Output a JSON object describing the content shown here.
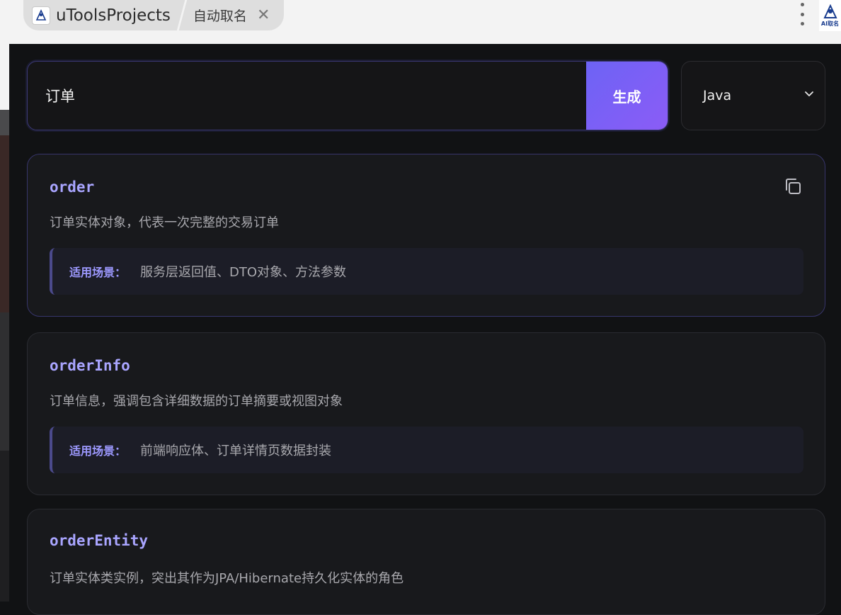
{
  "window": {
    "app_name": "uToolsProjects",
    "sub_title": "自动取名",
    "close_symbol": "✕",
    "logo_icon": "ai-naming-logo-icon",
    "plugin_avatar_text": "AI取名"
  },
  "search": {
    "value": "订单",
    "button_label": "生成"
  },
  "language": {
    "selected": "Java",
    "icon": "chevron-down-icon"
  },
  "scene_label": "适用场景：",
  "results": [
    {
      "name": "order",
      "description": "订单实体对象，代表一次完整的交易订单",
      "scene": "服务层返回值、DTO对象、方法参数"
    },
    {
      "name": "orderInfo",
      "description": "订单信息，强调包含详细数据的订单摘要或视图对象",
      "scene": "前端响应体、订单详情页数据封装"
    },
    {
      "name": "orderEntity",
      "description": "订单实体类实例，突出其作为JPA/Hibernate持久化实体的角色",
      "scene": ""
    }
  ],
  "colors": {
    "accent": "#8b5cf6",
    "name_color": "#a9a5ff",
    "background": "#111214"
  }
}
